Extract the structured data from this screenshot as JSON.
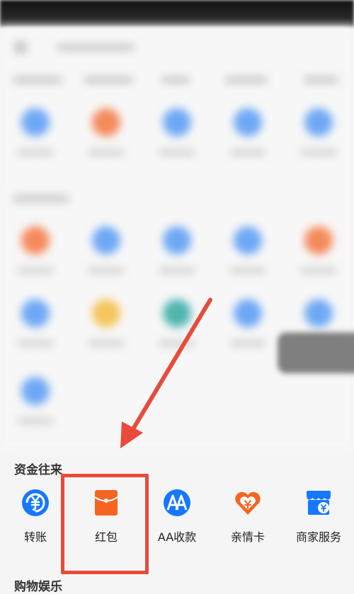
{
  "funds_section": {
    "title": "资金往来",
    "items": [
      {
        "label": "转账",
        "icon": "yuan-transfer-icon",
        "color": "#1677ff"
      },
      {
        "label": "红包",
        "icon": "red-packet-icon",
        "color": "#f5651f"
      },
      {
        "label": "AA收款",
        "icon": "aa-collect-icon",
        "color": "#1677ff"
      },
      {
        "label": "亲情卡",
        "icon": "heart-card-icon",
        "color": "#f5651f"
      },
      {
        "label": "商家服务",
        "icon": "merchant-store-icon",
        "color": "#1677ff"
      }
    ]
  },
  "shopping_section": {
    "title": "购物娱乐"
  },
  "annotation": {
    "highlight_color": "#e94a3a"
  }
}
